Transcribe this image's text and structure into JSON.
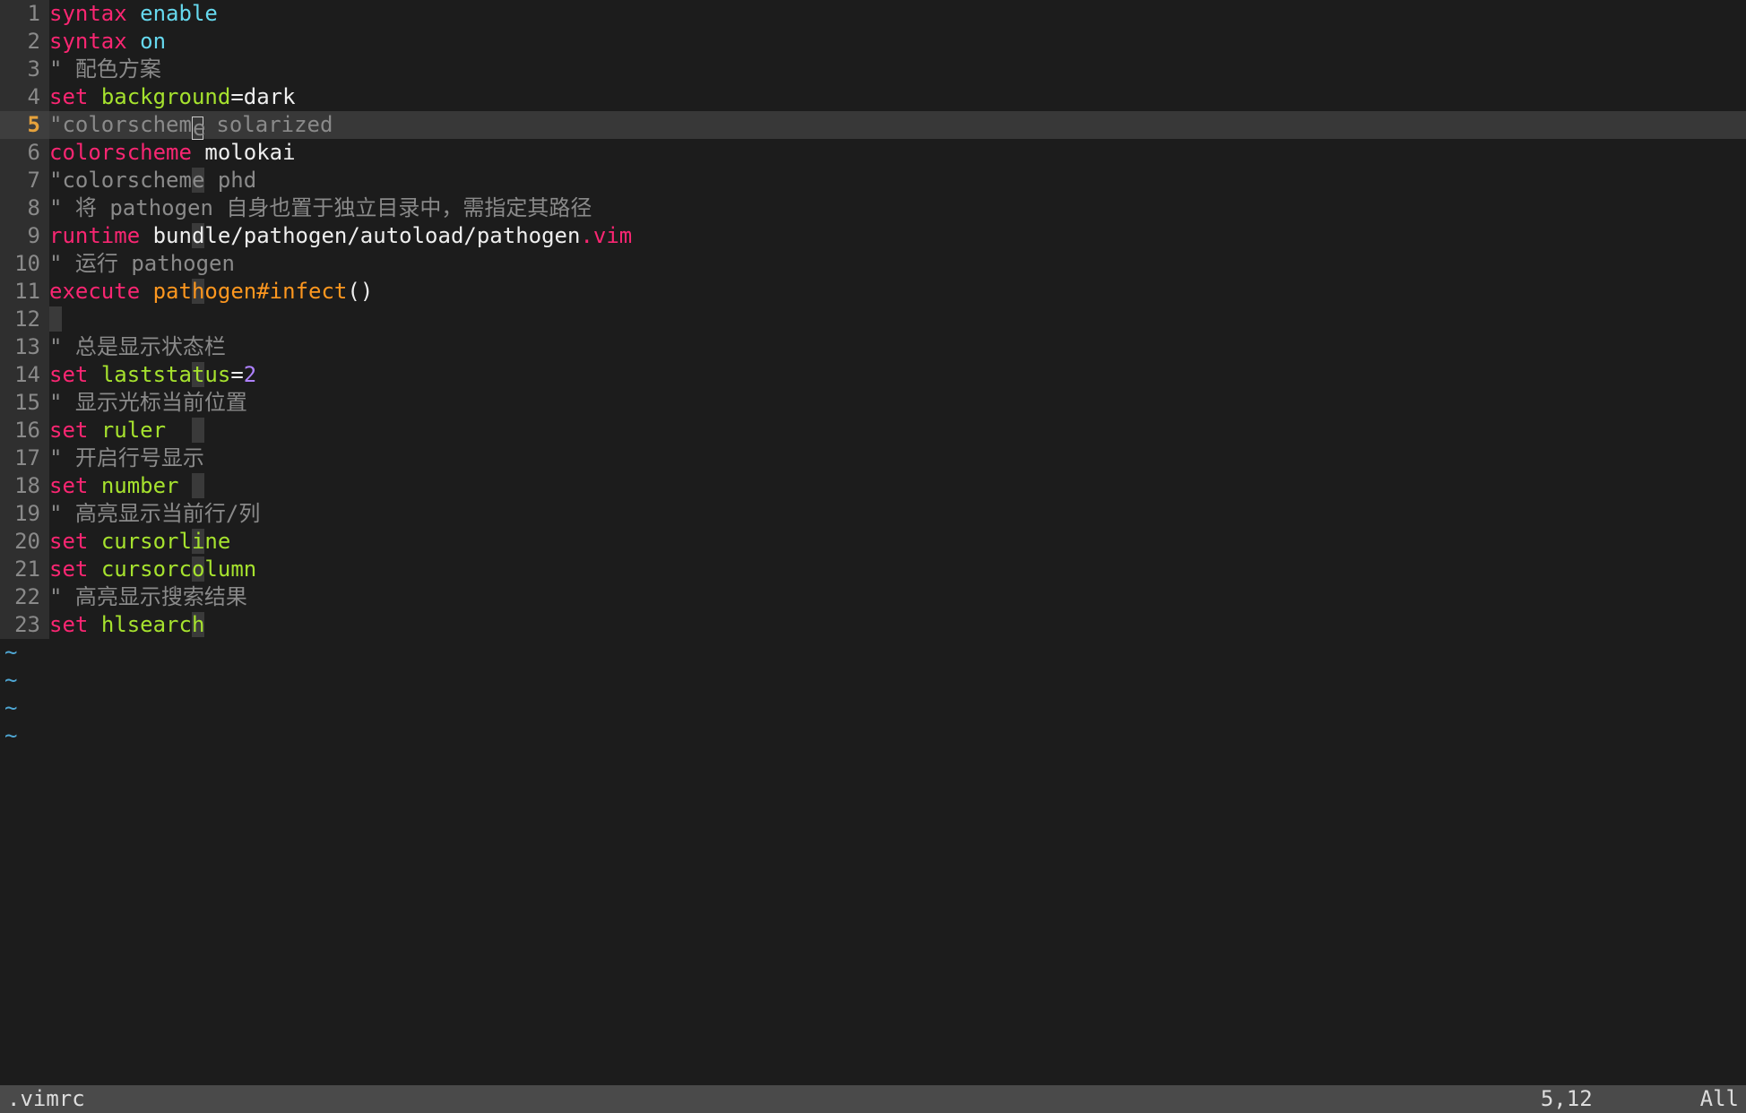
{
  "file": ".vimrc",
  "cursor": {
    "line": 5,
    "col": 12,
    "display": "5,12"
  },
  "scroll_indicator": "All",
  "tilde_rows": 4,
  "cursorcolumn_char_index": 11,
  "lines": [
    {
      "num": 1,
      "current": false,
      "tokens": [
        [
          "kw-pink",
          "syntax"
        ],
        [
          "text-plain",
          " "
        ],
        [
          "val-cyan",
          "enable"
        ]
      ]
    },
    {
      "num": 2,
      "current": false,
      "tokens": [
        [
          "kw-pink",
          "syntax"
        ],
        [
          "text-plain",
          " "
        ],
        [
          "val-cyan",
          "on"
        ]
      ]
    },
    {
      "num": 3,
      "current": false,
      "tokens": [
        [
          "comment",
          "\" 配色方案"
        ]
      ]
    },
    {
      "num": 4,
      "current": false,
      "tokens": [
        [
          "kw-pink",
          "set"
        ],
        [
          "text-plain",
          " "
        ],
        [
          "opt-green",
          "background"
        ],
        [
          "text-plain",
          "=dark"
        ]
      ]
    },
    {
      "num": 5,
      "current": true,
      "tokens": [
        [
          "comment",
          "\"colorschem"
        ],
        [
          "cursor",
          "e"
        ],
        [
          "comment",
          " solarized"
        ]
      ]
    },
    {
      "num": 6,
      "current": false,
      "tokens": [
        [
          "kw-pink",
          "colorscheme"
        ],
        [
          "text-plain",
          " molokai"
        ]
      ]
    },
    {
      "num": 7,
      "current": false,
      "tokens": [
        [
          "comment",
          "\"colorschem"
        ],
        [
          "comment-col",
          "e"
        ],
        [
          "comment",
          " phd"
        ]
      ]
    },
    {
      "num": 8,
      "current": false,
      "tokens": [
        [
          "comment",
          "\" 将 pathogen 自身也置于独立目录中，需指定其路径"
        ]
      ]
    },
    {
      "num": 9,
      "current": false,
      "tokens": [
        [
          "kw-pink",
          "runtime"
        ],
        [
          "text-plain",
          " bun"
        ],
        [
          "text-plain-col",
          "d"
        ],
        [
          "text-plain",
          "le/pathogen/autoload/pathogen"
        ],
        [
          "dot-pink",
          "."
        ],
        [
          "kw-pink",
          "vim"
        ]
      ]
    },
    {
      "num": 10,
      "current": false,
      "tokens": [
        [
          "comment",
          "\" 运行 pathogen"
        ]
      ]
    },
    {
      "num": 11,
      "current": false,
      "tokens": [
        [
          "kw-pink",
          "execute"
        ],
        [
          "text-plain",
          " "
        ],
        [
          "func-orange",
          "pat"
        ],
        [
          "func-orange-col",
          "h"
        ],
        [
          "func-orange",
          "ogen#infect"
        ],
        [
          "paren",
          "()"
        ]
      ]
    },
    {
      "num": 12,
      "current": false,
      "tokens": [
        [
          "pad-col",
          " "
        ]
      ]
    },
    {
      "num": 13,
      "current": false,
      "tokens": [
        [
          "comment",
          "\" 总是显示状态栏"
        ]
      ]
    },
    {
      "num": 14,
      "current": false,
      "tokens": [
        [
          "kw-pink",
          "set"
        ],
        [
          "text-plain",
          " "
        ],
        [
          "opt-green",
          "laststa"
        ],
        [
          "opt-green-col",
          "t"
        ],
        [
          "opt-green",
          "us"
        ],
        [
          "text-plain",
          "="
        ],
        [
          "num-purple",
          "2"
        ]
      ]
    },
    {
      "num": 15,
      "current": false,
      "tokens": [
        [
          "comment",
          "\" 显示光标当前位置"
        ]
      ]
    },
    {
      "num": 16,
      "current": false,
      "tokens": [
        [
          "kw-pink",
          "set"
        ],
        [
          "text-plain",
          " "
        ],
        [
          "opt-green",
          "ruler"
        ],
        [
          "pad-col2",
          " "
        ]
      ]
    },
    {
      "num": 17,
      "current": false,
      "tokens": [
        [
          "comment",
          "\" 开启行号显示"
        ]
      ]
    },
    {
      "num": 18,
      "current": false,
      "tokens": [
        [
          "kw-pink",
          "set"
        ],
        [
          "text-plain",
          " "
        ],
        [
          "opt-green",
          "number"
        ],
        [
          "pad-col1",
          " "
        ]
      ]
    },
    {
      "num": 19,
      "current": false,
      "tokens": [
        [
          "comment",
          "\" 高亮显示当前行/列"
        ]
      ]
    },
    {
      "num": 20,
      "current": false,
      "tokens": [
        [
          "kw-pink",
          "set"
        ],
        [
          "text-plain",
          " "
        ],
        [
          "opt-green",
          "cursorl"
        ],
        [
          "opt-green-col",
          "i"
        ],
        [
          "opt-green",
          "ne"
        ]
      ]
    },
    {
      "num": 21,
      "current": false,
      "tokens": [
        [
          "kw-pink",
          "set"
        ],
        [
          "text-plain",
          " "
        ],
        [
          "opt-green",
          "cursorc"
        ],
        [
          "opt-green-col",
          "o"
        ],
        [
          "opt-green",
          "lumn"
        ]
      ]
    },
    {
      "num": 22,
      "current": false,
      "tokens": [
        [
          "comment",
          "\" 高亮显示搜索结果"
        ]
      ]
    },
    {
      "num": 23,
      "current": false,
      "tokens": [
        [
          "kw-pink",
          "set"
        ],
        [
          "text-plain",
          " "
        ],
        [
          "opt-green",
          "hlsearc"
        ],
        [
          "opt-green-col",
          "h"
        ]
      ]
    }
  ]
}
